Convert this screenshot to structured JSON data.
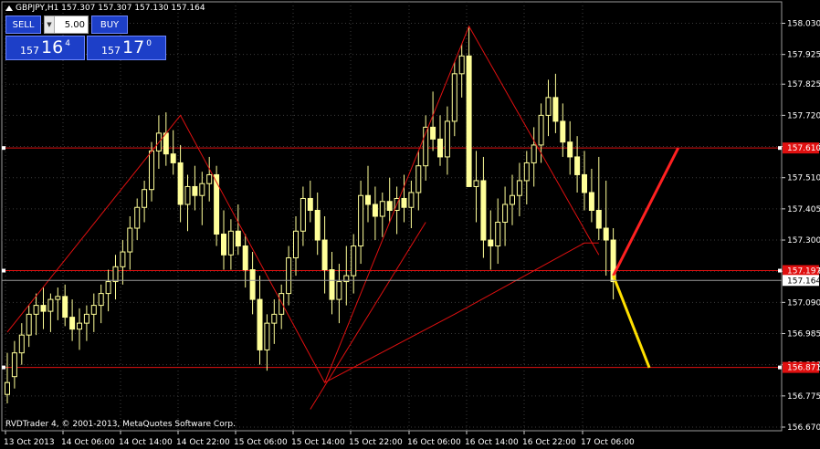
{
  "symbol_line": "GBPJPY,H1  157.307 157.307 157.130 157.164",
  "trade_panel": {
    "sell_label": "SELL",
    "buy_label": "BUY",
    "lot_value": "5.00",
    "sell_price": {
      "big": "157",
      "main": "16",
      "small": "4"
    },
    "buy_price": {
      "big": "157",
      "main": "17",
      "small": "0"
    }
  },
  "copyright": "RVDTrader 4, © 2001-2013, MetaQuotes Software Corp.",
  "colors": {
    "background": "#000000",
    "grid": "#3b3b3b",
    "candle": "#ffff99",
    "trend": "#e01010",
    "level": "#e01010",
    "projection_up": "#ff2020",
    "projection_down": "#ffe000",
    "text": "#ffffff"
  },
  "chart_data": {
    "type": "candlestick",
    "ylim": [
      156.67,
      158.09
    ],
    "y_ticks": [
      "158.030",
      "157.925",
      "157.825",
      "157.720",
      "157.615",
      "157.510",
      "157.405",
      "157.300",
      "157.195",
      "157.090",
      "156.985",
      "156.880",
      "156.775",
      "156.670"
    ],
    "x_ticks": [
      "13 Oct 2013",
      "14 Oct 06:00",
      "14 Oct 14:00",
      "14 Oct 22:00",
      "15 Oct 06:00",
      "15 Oct 14:00",
      "15 Oct 22:00",
      "16 Oct 06:00",
      "16 Oct 14:00",
      "16 Oct 22:00",
      "17 Oct 06:00"
    ],
    "current_price": "157.164",
    "level_labels": [
      {
        "price": 157.61,
        "label": "157.610"
      },
      {
        "price": 157.197,
        "label": "157.197"
      },
      {
        "price": 156.871,
        "label": "156.871"
      }
    ],
    "candles": [
      [
        156.78,
        156.92,
        156.75,
        156.82
      ],
      [
        156.84,
        156.96,
        156.8,
        156.92
      ],
      [
        156.92,
        157.02,
        156.88,
        156.98
      ],
      [
        156.98,
        157.08,
        156.94,
        157.05
      ],
      [
        157.05,
        157.12,
        156.98,
        157.08
      ],
      [
        157.08,
        157.14,
        157.0,
        157.06
      ],
      [
        157.06,
        157.12,
        156.99,
        157.1
      ],
      [
        157.1,
        157.14,
        157.03,
        157.11
      ],
      [
        157.11,
        157.15,
        157.01,
        157.04
      ],
      [
        157.04,
        157.1,
        156.96,
        157.0
      ],
      [
        157.0,
        157.07,
        156.93,
        157.02
      ],
      [
        157.02,
        157.08,
        156.96,
        157.05
      ],
      [
        157.05,
        157.12,
        156.99,
        157.08
      ],
      [
        157.08,
        157.15,
        157.02,
        157.12
      ],
      [
        157.12,
        157.2,
        157.06,
        157.16
      ],
      [
        157.16,
        157.25,
        157.1,
        157.21
      ],
      [
        157.21,
        157.3,
        157.15,
        157.26
      ],
      [
        157.26,
        157.38,
        157.2,
        157.34
      ],
      [
        157.34,
        157.44,
        157.3,
        157.41
      ],
      [
        157.41,
        157.5,
        157.36,
        157.47
      ],
      [
        157.47,
        157.63,
        157.43,
        157.6
      ],
      [
        157.6,
        157.72,
        157.54,
        157.66
      ],
      [
        157.66,
        157.73,
        157.55,
        157.59
      ],
      [
        157.59,
        157.67,
        157.52,
        157.56
      ],
      [
        157.56,
        157.62,
        157.36,
        157.42
      ],
      [
        157.42,
        157.52,
        157.33,
        157.48
      ],
      [
        157.48,
        157.55,
        157.4,
        157.45
      ],
      [
        157.45,
        157.53,
        157.35,
        157.49
      ],
      [
        157.49,
        157.58,
        157.43,
        157.52
      ],
      [
        157.52,
        157.55,
        157.28,
        157.32
      ],
      [
        157.32,
        157.4,
        157.2,
        157.25
      ],
      [
        157.25,
        157.37,
        157.2,
        157.33
      ],
      [
        157.33,
        157.42,
        157.25,
        157.28
      ],
      [
        157.28,
        157.32,
        157.14,
        157.2
      ],
      [
        157.2,
        157.26,
        157.05,
        157.1
      ],
      [
        157.1,
        157.18,
        156.88,
        156.93
      ],
      [
        156.93,
        157.05,
        156.86,
        157.02
      ],
      [
        157.02,
        157.1,
        156.95,
        157.05
      ],
      [
        157.05,
        157.15,
        157.0,
        157.12
      ],
      [
        157.12,
        157.28,
        157.08,
        157.24
      ],
      [
        157.24,
        157.38,
        157.18,
        157.33
      ],
      [
        157.33,
        157.48,
        157.28,
        157.44
      ],
      [
        157.44,
        157.5,
        157.36,
        157.4
      ],
      [
        157.4,
        157.46,
        157.25,
        157.3
      ],
      [
        157.3,
        157.38,
        157.12,
        157.2
      ],
      [
        157.2,
        157.26,
        157.05,
        157.1
      ],
      [
        157.1,
        157.22,
        157.02,
        157.16
      ],
      [
        157.16,
        157.28,
        157.08,
        157.18
      ],
      [
        157.18,
        157.32,
        157.12,
        157.28
      ],
      [
        157.28,
        157.5,
        157.22,
        157.45
      ],
      [
        157.45,
        157.55,
        157.36,
        157.42
      ],
      [
        157.42,
        157.48,
        157.3,
        157.38
      ],
      [
        157.38,
        157.46,
        157.31,
        157.43
      ],
      [
        157.43,
        157.51,
        157.36,
        157.4
      ],
      [
        157.4,
        157.48,
        157.32,
        157.44
      ],
      [
        157.44,
        157.52,
        157.36,
        157.41
      ],
      [
        157.41,
        157.5,
        157.34,
        157.46
      ],
      [
        157.46,
        157.6,
        157.4,
        157.55
      ],
      [
        157.55,
        157.72,
        157.5,
        157.68
      ],
      [
        157.68,
        157.8,
        157.6,
        157.64
      ],
      [
        157.64,
        157.72,
        157.55,
        157.58
      ],
      [
        157.58,
        157.75,
        157.52,
        157.7
      ],
      [
        157.7,
        157.9,
        157.65,
        157.86
      ],
      [
        157.86,
        157.96,
        157.78,
        157.92
      ],
      [
        157.92,
        158.02,
        157.78,
        157.48
      ],
      [
        157.48,
        157.6,
        157.36,
        157.5
      ],
      [
        157.5,
        157.58,
        157.24,
        157.3
      ],
      [
        157.3,
        157.4,
        157.2,
        157.28
      ],
      [
        157.28,
        157.44,
        157.22,
        157.36
      ],
      [
        157.36,
        157.48,
        157.28,
        157.42
      ],
      [
        157.42,
        157.52,
        157.35,
        157.45
      ],
      [
        157.45,
        157.56,
        157.38,
        157.5
      ],
      [
        157.5,
        157.6,
        157.42,
        157.56
      ],
      [
        157.56,
        157.68,
        157.48,
        157.62
      ],
      [
        157.62,
        157.76,
        157.56,
        157.72
      ],
      [
        157.72,
        157.84,
        157.65,
        157.78
      ],
      [
        157.78,
        157.86,
        157.66,
        157.7
      ],
      [
        157.7,
        157.76,
        157.58,
        157.63
      ],
      [
        157.63,
        157.7,
        157.52,
        157.58
      ],
      [
        157.58,
        157.65,
        157.46,
        157.52
      ],
      [
        157.52,
        157.6,
        157.4,
        157.46
      ],
      [
        157.46,
        157.54,
        157.36,
        157.4
      ],
      [
        157.4,
        157.58,
        157.3,
        157.34
      ],
      [
        157.34,
        157.5,
        157.18,
        157.3
      ],
      [
        157.3,
        157.34,
        157.1,
        157.16
      ]
    ],
    "trend_lines": [
      [
        [
          0,
          156.99
        ],
        [
          24,
          157.72
        ],
        [
          44,
          156.82
        ],
        [
          64,
          158.02
        ],
        [
          82,
          157.25
        ]
      ],
      [
        [
          42,
          156.73
        ],
        [
          58,
          157.36
        ]
      ],
      [
        [
          44,
          156.82
        ],
        [
          62,
          157.05
        ],
        [
          80,
          157.29
        ],
        [
          82,
          157.29
        ]
      ]
    ],
    "projection_up": [
      [
        84,
        157.18
      ],
      [
        93,
        157.61
      ]
    ],
    "projection_down": [
      [
        84,
        157.18
      ],
      [
        89,
        156.87
      ]
    ]
  }
}
